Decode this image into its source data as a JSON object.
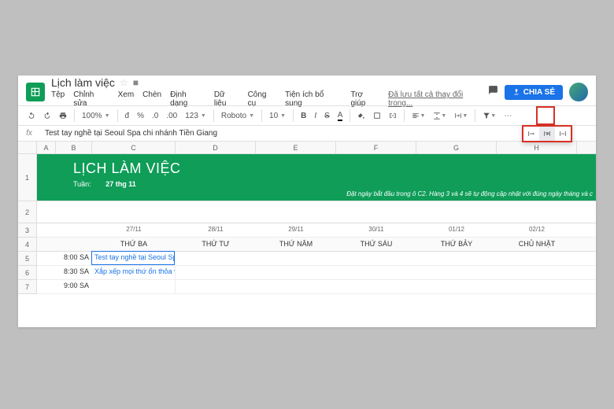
{
  "doc": {
    "title": "Lịch làm việc"
  },
  "menu": {
    "file": "Tệp",
    "edit": "Chỉnh sửa",
    "view": "Xem",
    "insert": "Chèn",
    "format": "Định dạng",
    "data": "Dữ liệu",
    "tools": "Công cụ",
    "addons": "Tiện ích bổ sung",
    "help": "Trợ giúp",
    "saved": "Đã lưu tất cả thay đổi trong..."
  },
  "share": "CHIA SẺ",
  "toolbar": {
    "zoom": "100%",
    "currency": "đ",
    "percent": "%",
    "font": "Roboto",
    "size": "10"
  },
  "formula": "Test tay nghề tại Seoul Spa chi nhánh Tiền Giang",
  "cols": [
    "A",
    "B",
    "C",
    "D",
    "E",
    "F",
    "G",
    "H"
  ],
  "banner": {
    "title": "LỊCH LÀM VIỆC",
    "week_label": "Tuần:",
    "week_value": "27 thg 11",
    "note": "Đặt ngày bắt đầu trong ô C2. Hàng 3 và 4 sẽ tự động cập nhật với đúng ngày tháng và c"
  },
  "dates": [
    "27/11",
    "28/11",
    "29/11",
    "30/11",
    "01/12",
    "02/12"
  ],
  "days": [
    "THỨ BA",
    "THỨ TƯ",
    "THỨ NĂM",
    "THỨ SÁU",
    "THỨ BẢY",
    "CHỦ NHẬT"
  ],
  "rows": [
    {
      "time": "8:00 SA",
      "task": "Test tay nghề tại Seoul Sp"
    },
    {
      "time": "8:30 SA",
      "task": "Xắp xếp mọi thứ ổn thỏa v"
    },
    {
      "time": "9:00 SA",
      "task": ""
    }
  ]
}
